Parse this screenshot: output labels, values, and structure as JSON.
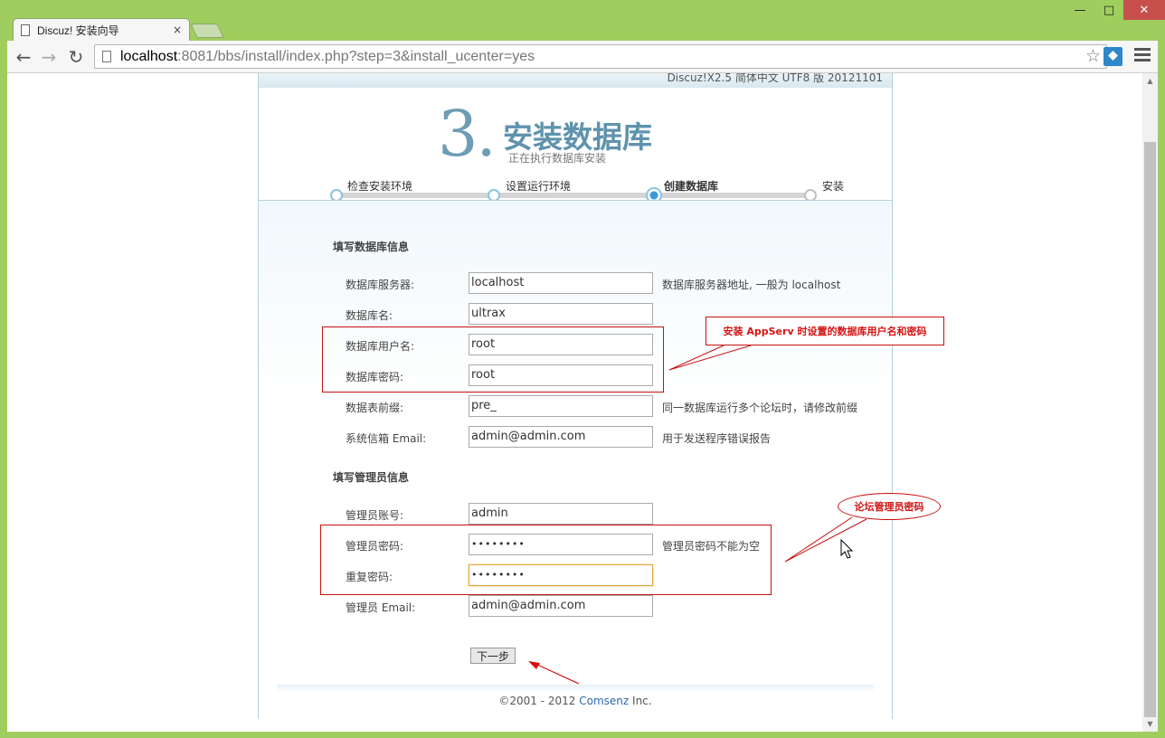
{
  "browser": {
    "tab_title": "Discuz! 安装向导",
    "tab_close": "×",
    "url_host": "localhost",
    "url_rest": ":8081/bbs/install/index.php?step=3&install_ucenter=yes",
    "window_controls": {
      "minimize": "—",
      "maximize": "□",
      "close": "✕"
    },
    "nav": {
      "back": "←",
      "forward": "→",
      "reload": "↻"
    },
    "star": "☆"
  },
  "page": {
    "version": "Discuz!X2.5 简体中文 UTF8 版 20121101",
    "step_number": "3.",
    "title": "安装数据库",
    "subtitle": "正在执行数据库安装",
    "steps": [
      "检查安装环境",
      "设置运行环境",
      "创建数据库",
      "安装"
    ],
    "db_section": {
      "title": "填写数据库信息",
      "fields": [
        {
          "label": "数据库服务器:",
          "value": "localhost",
          "hint": "数据库服务器地址, 一般为 localhost"
        },
        {
          "label": "数据库名:",
          "value": "ultrax",
          "hint": ""
        },
        {
          "label": "数据库用户名:",
          "value": "root",
          "hint": ""
        },
        {
          "label": "数据库密码:",
          "value": "root",
          "hint": ""
        },
        {
          "label": "数据表前缀:",
          "value": "pre_",
          "hint": "同一数据库运行多个论坛时，请修改前缀"
        },
        {
          "label": "系统信箱 Email:",
          "value": "admin@admin.com",
          "hint": "用于发送程序错误报告"
        }
      ]
    },
    "admin_section": {
      "title": "填写管理员信息",
      "fields": [
        {
          "label": "管理员账号:",
          "value": "admin",
          "hint": ""
        },
        {
          "label": "管理员密码:",
          "value": "••••••••",
          "hint": "管理员密码不能为空"
        },
        {
          "label": "重复密码:",
          "value": "••••••••",
          "hint": ""
        },
        {
          "label": "管理员 Email:",
          "value": "admin@admin.com",
          "hint": ""
        }
      ]
    },
    "next_button": "下一步",
    "footer_prefix": "©2001 - 2012 ",
    "footer_brand": "Comsenz",
    "footer_suffix": " Inc."
  },
  "annotations": {
    "db_note": "安装 AppServ 时设置的数据库用户名和密码",
    "admin_note": "论坛管理员密码"
  },
  "colors": {
    "annotation_red": "#c81010",
    "title_blue": "#5f93ad",
    "chrome_green": "#9fcd5e"
  }
}
